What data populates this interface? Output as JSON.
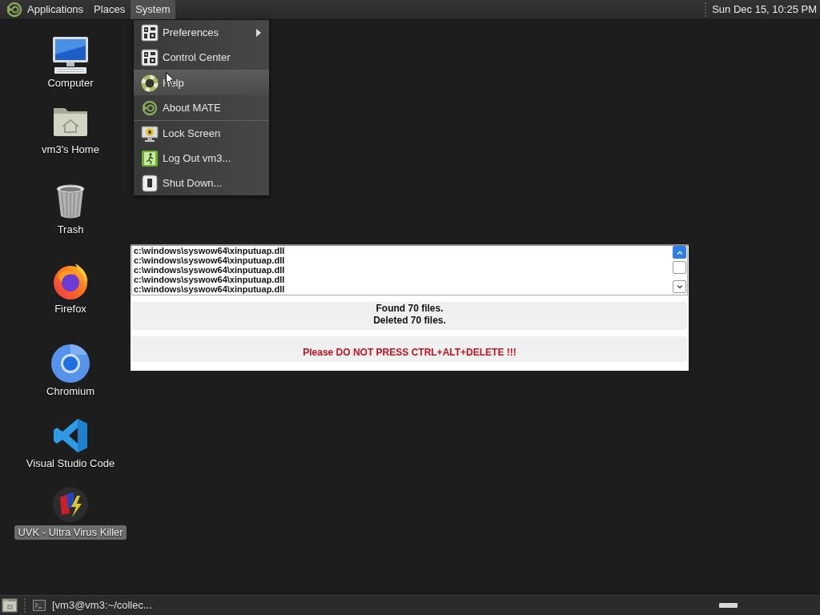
{
  "top_panel": {
    "menus": [
      {
        "label": "Applications",
        "selected": false
      },
      {
        "label": "Places",
        "selected": false
      },
      {
        "label": "System",
        "selected": true
      }
    ],
    "clock": "Sun Dec 15, 10:25 PM"
  },
  "system_menu": {
    "sections": [
      [
        {
          "label": "Preferences",
          "submenu": true,
          "highlighted": false
        },
        {
          "label": "Control Center",
          "submenu": false,
          "highlighted": false
        }
      ],
      [
        {
          "label": "Help",
          "submenu": false,
          "highlighted": true
        },
        {
          "label": "About MATE",
          "submenu": false,
          "highlighted": false
        }
      ],
      [
        {
          "label": "Lock Screen",
          "submenu": false,
          "highlighted": false
        },
        {
          "label": "Log Out vm3...",
          "submenu": false,
          "highlighted": false
        },
        {
          "label": "Shut Down...",
          "submenu": false,
          "highlighted": false
        }
      ]
    ]
  },
  "desktop_icons": [
    {
      "label": "Computer",
      "selected": false
    },
    {
      "label": "vm3's Home",
      "selected": false
    },
    {
      "label": "Trash",
      "selected": false
    },
    {
      "label": "Firefox",
      "selected": false
    },
    {
      "label": "Chromium",
      "selected": false
    },
    {
      "label": "Visual Studio Code",
      "selected": false
    },
    {
      "label": "UVK - Ultra Virus Killer",
      "selected": true
    }
  ],
  "dialog": {
    "file_list": [
      "c:\\windows\\syswow64\\xinputuap.dll",
      "c:\\windows\\syswow64\\xinputuap.dll",
      "c:\\windows\\syswow64\\xinputuap.dll",
      "c:\\windows\\syswow64\\xinputuap.dll",
      "c:\\windows\\syswow64\\xinputuap.dll"
    ],
    "status_lines": [
      "Found 70 files.",
      "Deleted 70 files."
    ],
    "warning": "Please DO NOT PRESS CTRL+ALT+DELETE !!!"
  },
  "bottom_panel": {
    "windows": [
      {
        "label": "[vm3@vm3:~/collec..."
      }
    ]
  }
}
